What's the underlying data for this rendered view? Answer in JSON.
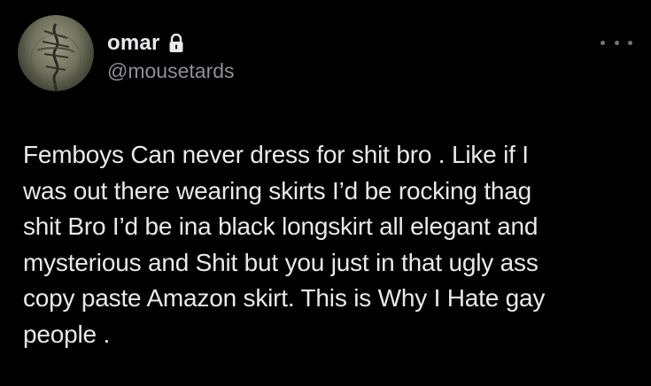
{
  "author": {
    "display_name": "omar",
    "handle": "@mousetards",
    "protected": true
  },
  "icons": {
    "lock": "lock-icon",
    "more": "more-horizontal-icon",
    "avatar": "avatar-image"
  },
  "tweet": {
    "text": "Femboys Can never dress for shit bro . Like if I\nwas out there wearing skirts I’d be rocking thag\nshit Bro I’d be ina black longskirt all elegant and\nmysterious and Shit but you just in that ugly ass\ncopy paste Amazon skirt. This is Why I Hate gay\npeople ."
  },
  "colors": {
    "background": "#000000",
    "primary_text": "#e7e9ea",
    "secondary_text": "#8b9197"
  }
}
